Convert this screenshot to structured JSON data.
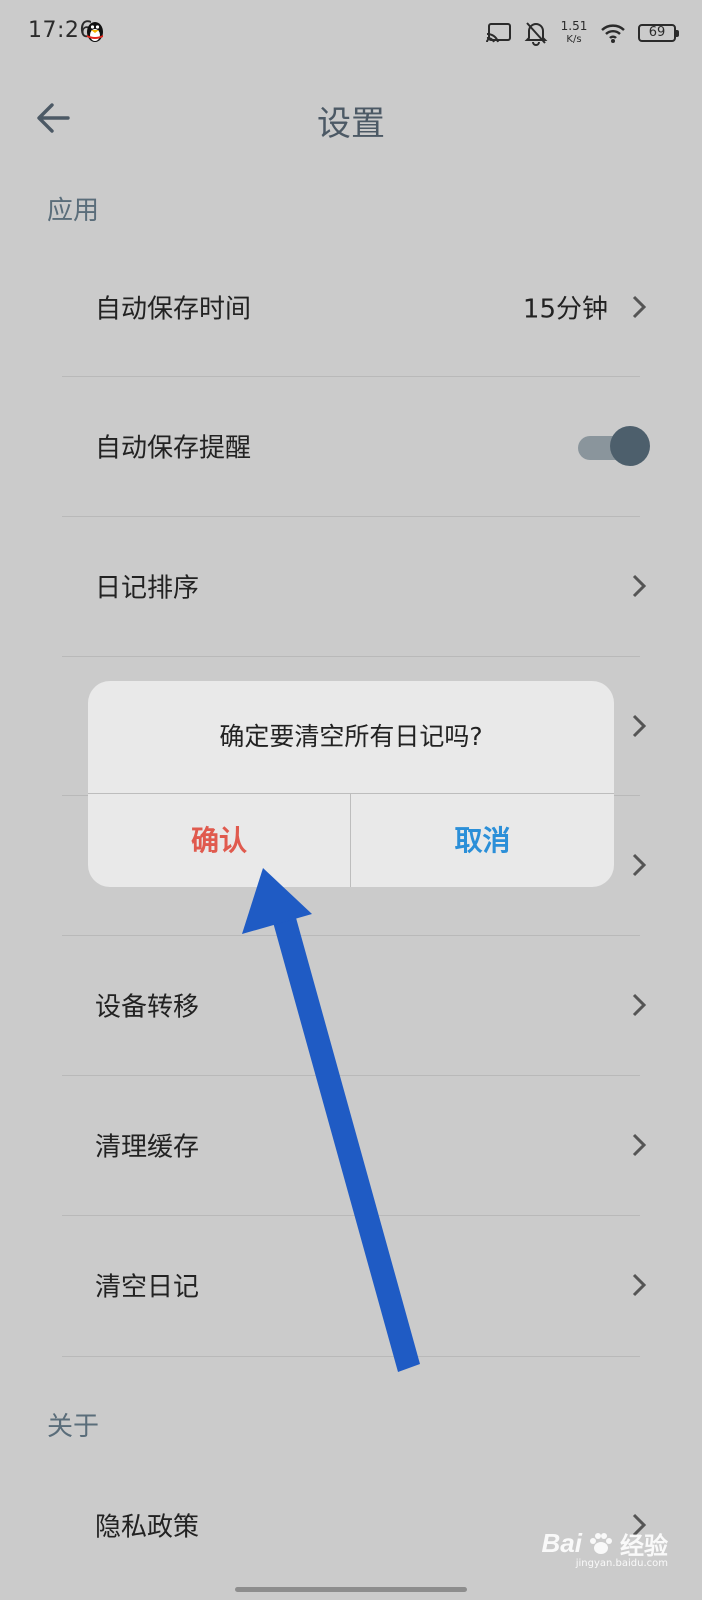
{
  "status_bar": {
    "time": "17:26",
    "net_speed_value": "1.51",
    "net_speed_unit": "K/s",
    "battery": "69"
  },
  "header": {
    "title": "设置"
  },
  "sections": {
    "app": "应用",
    "about": "关于"
  },
  "rows": [
    {
      "label": "自动保存时间",
      "value": "15分钟"
    },
    {
      "label": "自动保存提醒",
      "toggle_on": true
    },
    {
      "label": "日记排序"
    },
    {
      "label": "设备转移"
    },
    {
      "label": "清理缓存"
    },
    {
      "label": "清空日记"
    },
    {
      "label": "隐私政策"
    }
  ],
  "dialog": {
    "message": "确定要清空所有日记吗?",
    "confirm": "确认",
    "cancel": "取消"
  },
  "watermark": {
    "brand": "Bai",
    "suffix": "经验",
    "url": "jingyan.baidu.com"
  },
  "colors": {
    "confirm": "#e05a4e",
    "cancel": "#2b8fd8",
    "annotation_arrow": "#1f5bc4",
    "toggle_knob": "#4d5f6c"
  }
}
